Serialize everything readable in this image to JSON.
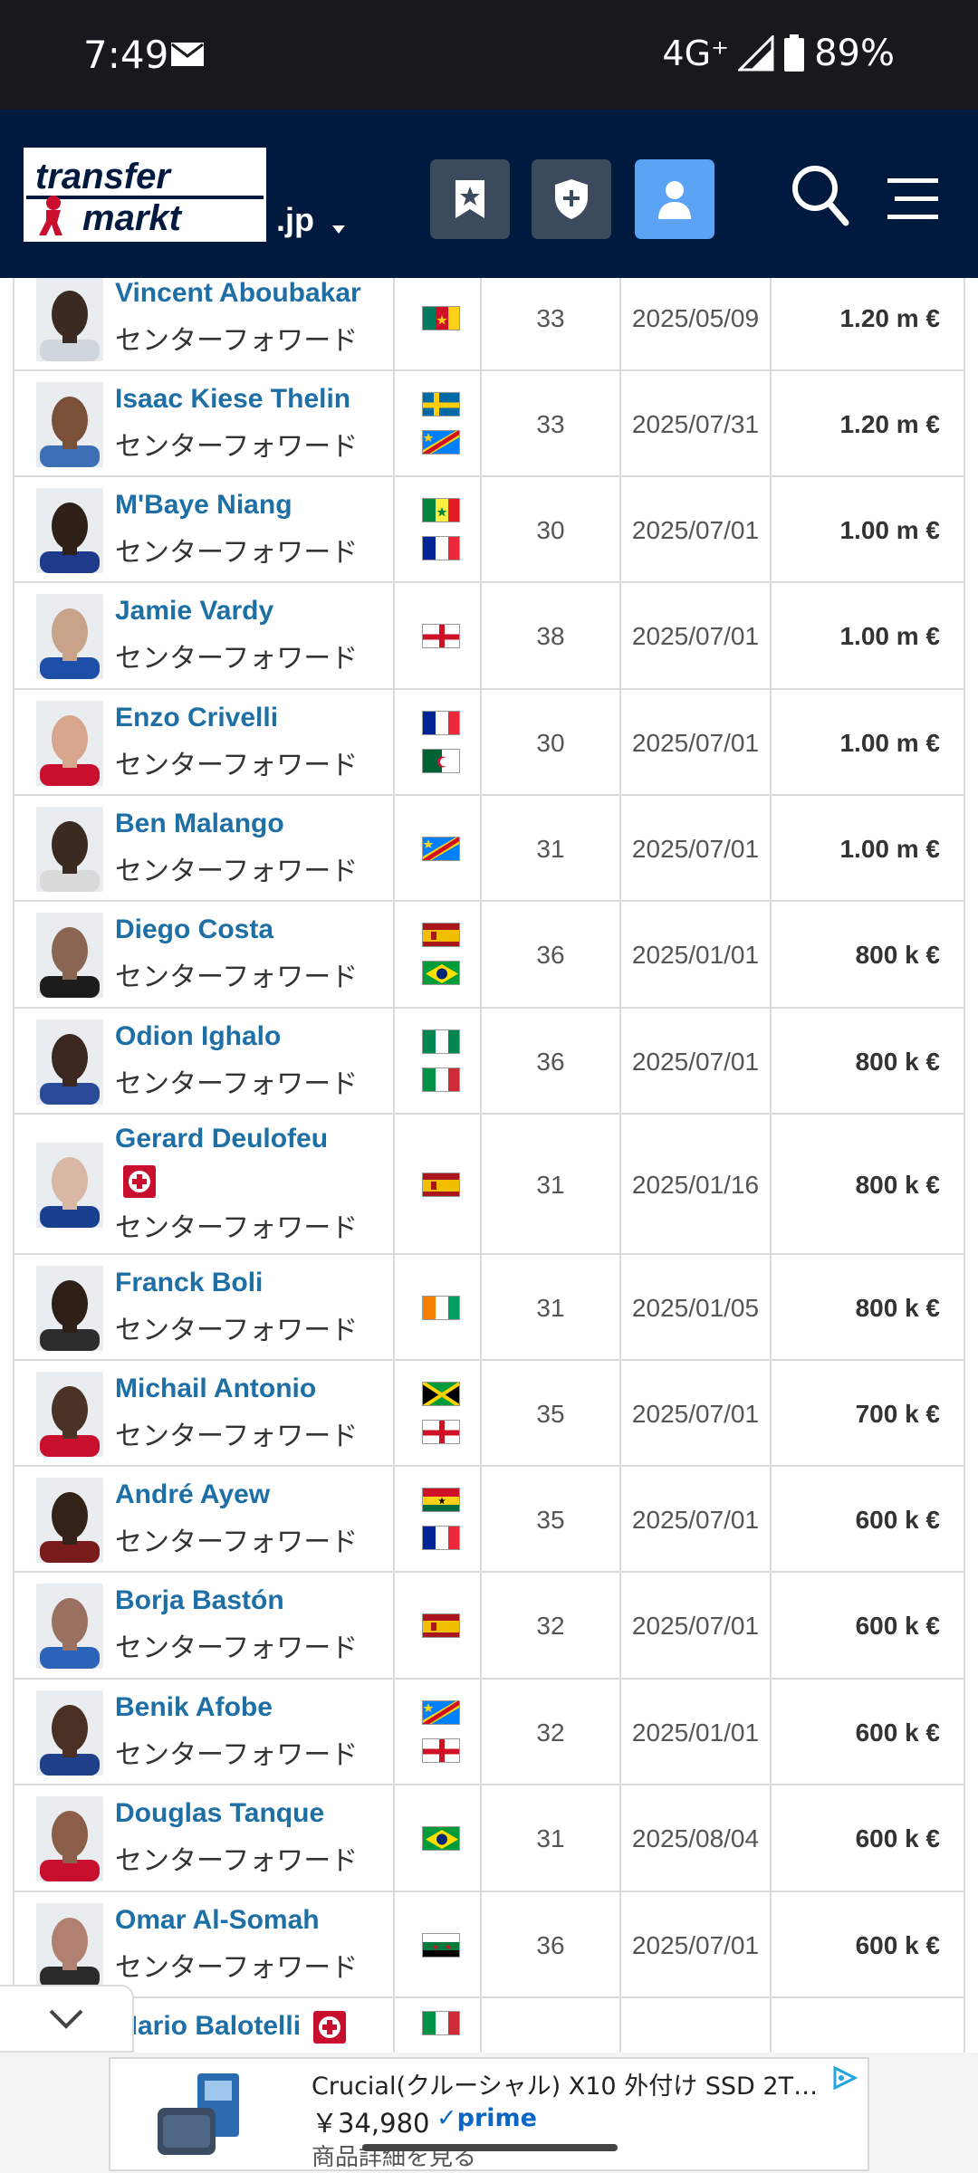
{
  "status_bar": {
    "time": "7:49",
    "network": "4G⁺",
    "battery": "89%"
  },
  "header": {
    "logo_line1": "transfer",
    "logo_line2": "markt",
    "tld": ".jp"
  },
  "players": [
    {
      "name": "Vincent Aboubakar",
      "position": "センターフォワード",
      "flags": [
        "cameroon"
      ],
      "age": "33",
      "date": "2025/05/09",
      "value": "1.20 m €"
    },
    {
      "name": "Isaac Kiese Thelin",
      "position": "センターフォワード",
      "flags": [
        "sweden",
        "drcongo"
      ],
      "age": "33",
      "date": "2025/07/31",
      "value": "1.20 m €"
    },
    {
      "name": "M'Baye Niang",
      "position": "センターフォワード",
      "flags": [
        "senegal",
        "france"
      ],
      "age": "30",
      "date": "2025/07/01",
      "value": "1.00 m €"
    },
    {
      "name": "Jamie Vardy",
      "position": "センターフォワード",
      "flags": [
        "england"
      ],
      "age": "38",
      "date": "2025/07/01",
      "value": "1.00 m €"
    },
    {
      "name": "Enzo Crivelli",
      "position": "センターフォワード",
      "flags": [
        "france",
        "algeria"
      ],
      "age": "30",
      "date": "2025/07/01",
      "value": "1.00 m €"
    },
    {
      "name": "Ben Malango",
      "position": "センターフォワード",
      "flags": [
        "drcongo"
      ],
      "age": "31",
      "date": "2025/07/01",
      "value": "1.00 m €"
    },
    {
      "name": "Diego Costa",
      "position": "センターフォワード",
      "flags": [
        "spain",
        "brazil"
      ],
      "age": "36",
      "date": "2025/01/01",
      "value": "800 k €"
    },
    {
      "name": "Odion Ighalo",
      "position": "センターフォワード",
      "flags": [
        "nigeria",
        "italy"
      ],
      "age": "36",
      "date": "2025/07/01",
      "value": "800 k €"
    },
    {
      "name": "Gerard Deulofeu",
      "position": "センターフォワード",
      "flags": [
        "spain"
      ],
      "age": "31",
      "date": "2025/01/16",
      "value": "800 k €",
      "injury": true
    },
    {
      "name": "Franck Boli",
      "position": "センターフォワード",
      "flags": [
        "ivorycoast"
      ],
      "age": "31",
      "date": "2025/01/05",
      "value": "800 k €"
    },
    {
      "name": "Michail Antonio",
      "position": "センターフォワード",
      "flags": [
        "jamaica",
        "england"
      ],
      "age": "35",
      "date": "2025/07/01",
      "value": "700 k €"
    },
    {
      "name": "André Ayew",
      "position": "センターフォワード",
      "flags": [
        "ghana",
        "france"
      ],
      "age": "35",
      "date": "2025/07/01",
      "value": "600 k €"
    },
    {
      "name": "Borja Bastón",
      "position": "センターフォワード",
      "flags": [
        "spain"
      ],
      "age": "32",
      "date": "2025/07/01",
      "value": "600 k €"
    },
    {
      "name": "Benik Afobe",
      "position": "センターフォワード",
      "flags": [
        "drcongo",
        "england"
      ],
      "age": "32",
      "date": "2025/01/01",
      "value": "600 k €"
    },
    {
      "name": "Douglas Tanque",
      "position": "センターフォワード",
      "flags": [
        "brazil"
      ],
      "age": "31",
      "date": "2025/08/04",
      "value": "600 k €"
    },
    {
      "name": "Omar Al-Somah",
      "position": "センターフォワード",
      "flags": [
        "syria"
      ],
      "age": "36",
      "date": "2025/07/01",
      "value": "600 k €"
    },
    {
      "name": "Mario Balotelli",
      "position": "",
      "flags": [
        "italy"
      ],
      "age": "",
      "date": "",
      "value": "",
      "injury": true
    }
  ],
  "ad": {
    "title": "Crucial(クルーシャル) X10 外付け SSD 2TB…",
    "price": "￥34,980",
    "prime": "✓prime",
    "more": "商品詳細を見る"
  }
}
